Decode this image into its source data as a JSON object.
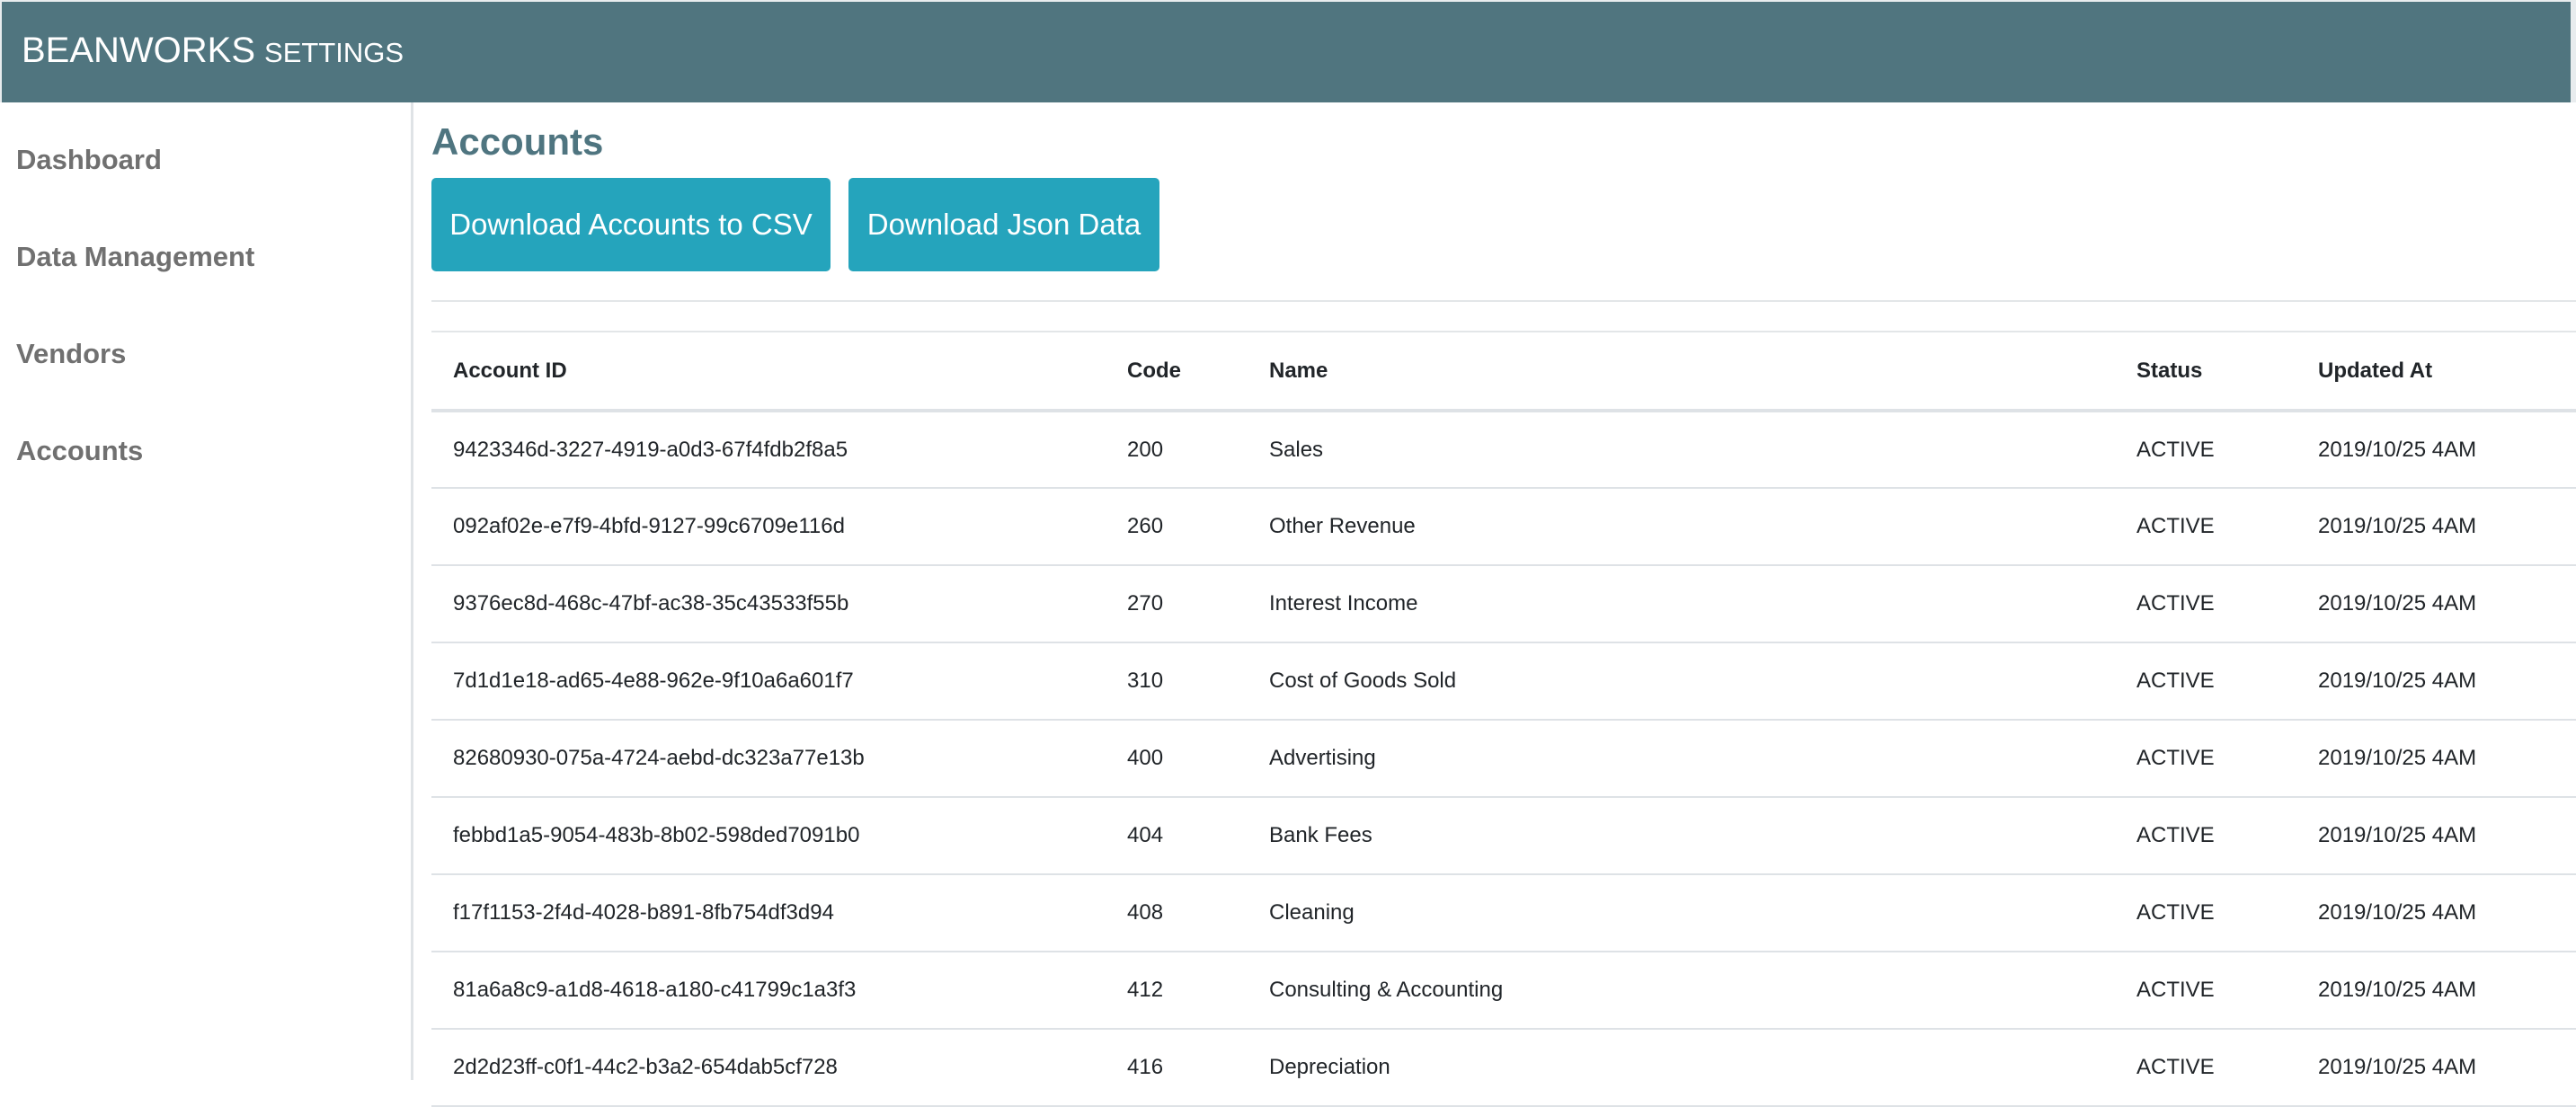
{
  "header": {
    "brand": "BEANWORKS",
    "brand_sub": "SETTINGS"
  },
  "sidebar": {
    "items": [
      {
        "label": "Dashboard"
      },
      {
        "label": "Data Management"
      },
      {
        "label": "Vendors"
      },
      {
        "label": "Accounts"
      }
    ]
  },
  "main": {
    "title": "Accounts",
    "buttons": {
      "csv": "Download Accounts to CSV",
      "json": "Download Json Data"
    },
    "table": {
      "columns": [
        "Account ID",
        "Code",
        "Name",
        "Status",
        "Updated At"
      ],
      "rows": [
        [
          "9423346d-3227-4919-a0d3-67f4fdb2f8a5",
          "200",
          "Sales",
          "ACTIVE",
          "2019/10/25 4AM"
        ],
        [
          "092af02e-e7f9-4bfd-9127-99c6709e116d",
          "260",
          "Other Revenue",
          "ACTIVE",
          "2019/10/25 4AM"
        ],
        [
          "9376ec8d-468c-47bf-ac38-35c43533f55b",
          "270",
          "Interest Income",
          "ACTIVE",
          "2019/10/25 4AM"
        ],
        [
          "7d1d1e18-ad65-4e88-962e-9f10a6a601f7",
          "310",
          "Cost of Goods Sold",
          "ACTIVE",
          "2019/10/25 4AM"
        ],
        [
          "82680930-075a-4724-aebd-dc323a77e13b",
          "400",
          "Advertising",
          "ACTIVE",
          "2019/10/25 4AM"
        ],
        [
          "febbd1a5-9054-483b-8b02-598ded7091b0",
          "404",
          "Bank Fees",
          "ACTIVE",
          "2019/10/25 4AM"
        ],
        [
          "f17f1153-2f4d-4028-b891-8fb754df3d94",
          "408",
          "Cleaning",
          "ACTIVE",
          "2019/10/25 4AM"
        ],
        [
          "81a6a8c9-a1d8-4618-a180-c41799c1a3f3",
          "412",
          "Consulting & Accounting",
          "ACTIVE",
          "2019/10/25 4AM"
        ],
        [
          "2d2d23ff-c0f1-44c2-b3a2-654dab5cf728",
          "416",
          "Depreciation",
          "ACTIVE",
          "2019/10/25 4AM"
        ]
      ]
    }
  },
  "colors": {
    "header_bg": "#50757f",
    "title": "#4f7580",
    "button_bg": "#25a4bc",
    "sidebar_text": "#707070"
  }
}
